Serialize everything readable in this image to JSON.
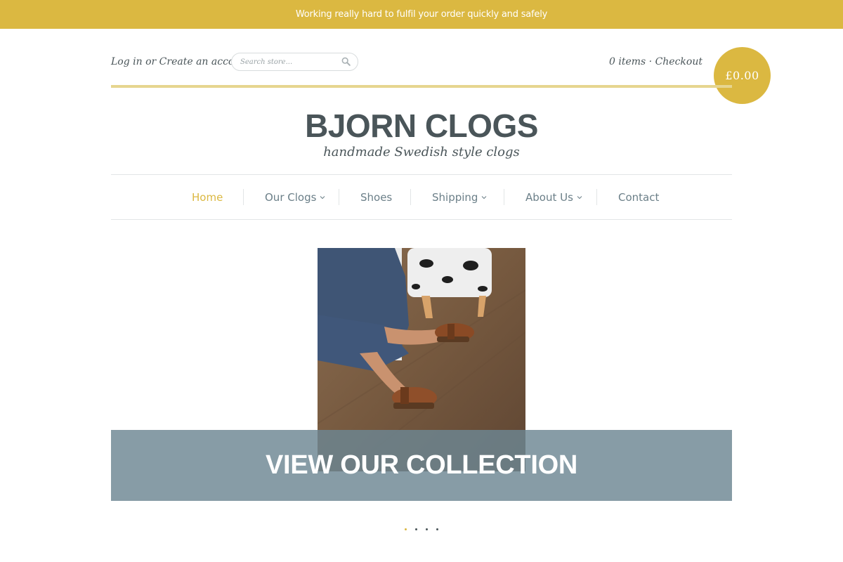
{
  "announcement": "Working really hard to fulfil your order quickly and safely",
  "account": {
    "login": "Log in",
    "or": " or ",
    "create": "Create an account"
  },
  "search": {
    "placeholder": "Search store...",
    "icon": "search-icon"
  },
  "cart": {
    "items": "0 items",
    "separator": " · ",
    "checkout": "Checkout",
    "total": "£0.00"
  },
  "brand": {
    "name": "BJORN CLOGS",
    "tagline": "handmade Swedish style clogs"
  },
  "nav": {
    "items": [
      {
        "label": "Home",
        "active": true,
        "dropdown": false
      },
      {
        "label": "Our Clogs",
        "active": false,
        "dropdown": true
      },
      {
        "label": "Shoes",
        "active": false,
        "dropdown": false
      },
      {
        "label": "Shipping",
        "active": false,
        "dropdown": true
      },
      {
        "label": "About Us",
        "active": false,
        "dropdown": true
      },
      {
        "label": "Contact",
        "active": false,
        "dropdown": false
      }
    ]
  },
  "slideshow": {
    "banner": "VIEW OUR COLLECTION",
    "slide_count": 4,
    "active_slide": 1
  },
  "colors": {
    "accent": "#dbb841",
    "text": "#4a5559",
    "nav_text": "#6b7f88",
    "banner_overlay": "#6c8692"
  }
}
